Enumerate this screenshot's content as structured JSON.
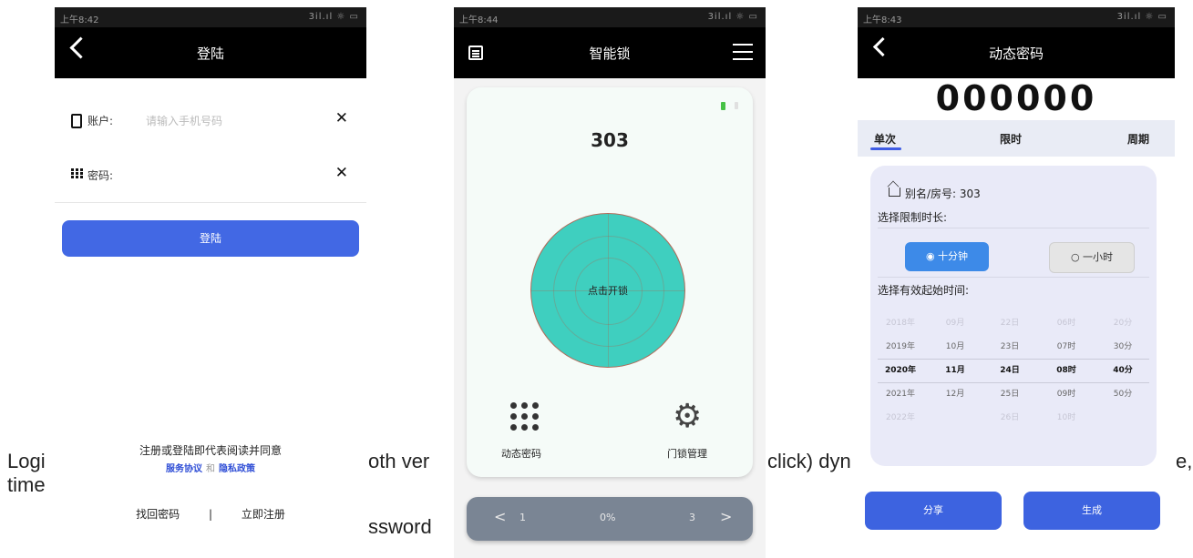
{
  "caption": {
    "line1_a": "Logi",
    "line1_b": "oth ver",
    "line1_c": "click) dyn",
    "line1_d": "e,",
    "line2_a": "time",
    "line2_b": "ssword"
  },
  "login": {
    "status_left": "上午8:42",
    "status_right": "3il.ıl ☼ ▭",
    "title": "登陆",
    "account_label": "账户:",
    "account_placeholder": "请输入手机号码",
    "password_label": "密码:",
    "clear_glyph": "✕",
    "login_button": "登陆",
    "agree_text": "注册或登陆即代表阅读并同意",
    "service_link": "服务协议",
    "and_text": "和",
    "privacy_link": "隐私政策",
    "forgot": "找回密码",
    "separator": "|",
    "register": "立即注册"
  },
  "lock": {
    "status_left": "上午8:44",
    "status_right": "3il.ıl ☼ ▭",
    "title": "智能锁",
    "room": "303",
    "unlock_text": "点击开锁",
    "dynamic_pw": "动态密码",
    "door_mgmt": "门锁管理",
    "pager_prev": "<",
    "pager_left": "1",
    "pager_mid": "0%",
    "pager_right": "3",
    "pager_next": ">"
  },
  "dynamic": {
    "status_left": "上午8:43",
    "status_right": "3il.ıl ☼ ▭",
    "title": "动态密码",
    "code": "000000",
    "tabs": [
      "单次",
      "限时",
      "周期"
    ],
    "alias": "别名/房号: 303",
    "limit_label": "选择限制时长:",
    "option_on": "◉ 十分钟",
    "option_off": "○ 一小时",
    "start_label": "选择有效起始时间:",
    "years": [
      "2018年",
      "2019年",
      "2020年",
      "2021年",
      "2022年"
    ],
    "months": [
      "09月",
      "10月",
      "11月",
      "12月",
      ""
    ],
    "days": [
      "22日",
      "23日",
      "24日",
      "25日",
      "26日"
    ],
    "hours": [
      "06时",
      "07时",
      "08时",
      "09时",
      "10时"
    ],
    "minutes": [
      "20分",
      "30分",
      "40分",
      "50分",
      ""
    ],
    "share": "分享",
    "generate": "生成"
  }
}
